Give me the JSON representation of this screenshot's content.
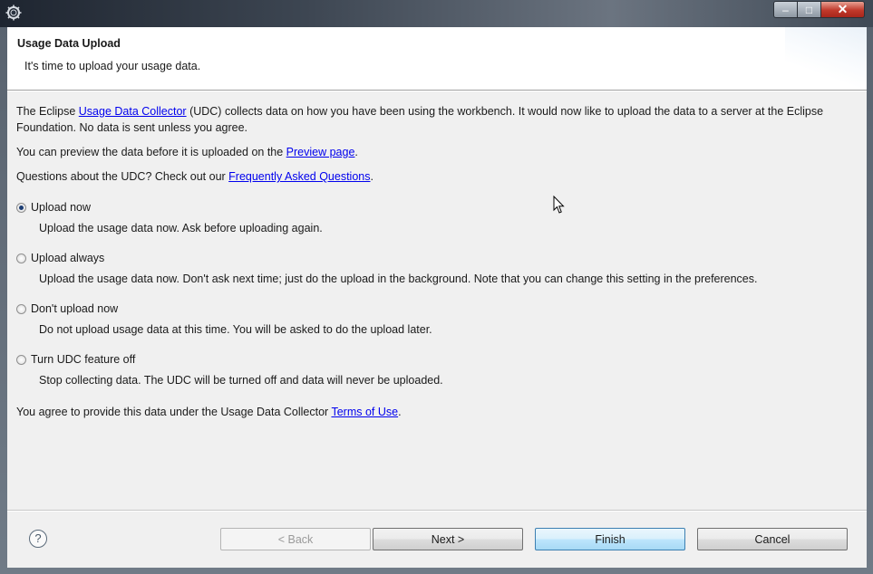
{
  "window": {
    "controls": {
      "minimize": "–",
      "maximize": "□",
      "close": "✕"
    }
  },
  "banner": {
    "title": "Usage Data Upload",
    "description": "It's time to upload your usage data."
  },
  "intro": {
    "p1_before": "The Eclipse ",
    "p1_link": "Usage Data Collector",
    "p1_after": " (UDC) collects data on how you have been using the workbench. It would now like to upload the data to a server at the Eclipse Foundation. No data is sent unless you agree.",
    "p2_before": "You can preview the data before it is uploaded on the ",
    "p2_link": "Preview page",
    "p2_after": ".",
    "p3_before": "Questions about the UDC? Check out our ",
    "p3_link": "Frequently Asked Questions",
    "p3_after": "."
  },
  "options": [
    {
      "label": "Upload now",
      "description": "Upload the usage data now. Ask before uploading again.",
      "selected": true
    },
    {
      "label": "Upload always",
      "description": "Upload the usage data now. Don't ask next time; just do the upload in the background. Note that you can change this setting in the preferences.",
      "selected": false
    },
    {
      "label": "Don't upload now",
      "description": "Do not upload usage data at this time. You will be asked to do the upload later.",
      "selected": false
    },
    {
      "label": "Turn UDC feature off",
      "description": "Stop collecting data. The UDC will be turned off and data will never be uploaded.",
      "selected": false
    }
  ],
  "terms": {
    "before": "You agree to provide this data under the Usage Data Collector ",
    "link": "Terms of Use",
    "after": "."
  },
  "buttons": {
    "help": "?",
    "back": "< Back",
    "next": "Next >",
    "finish": "Finish",
    "cancel": "Cancel"
  }
}
